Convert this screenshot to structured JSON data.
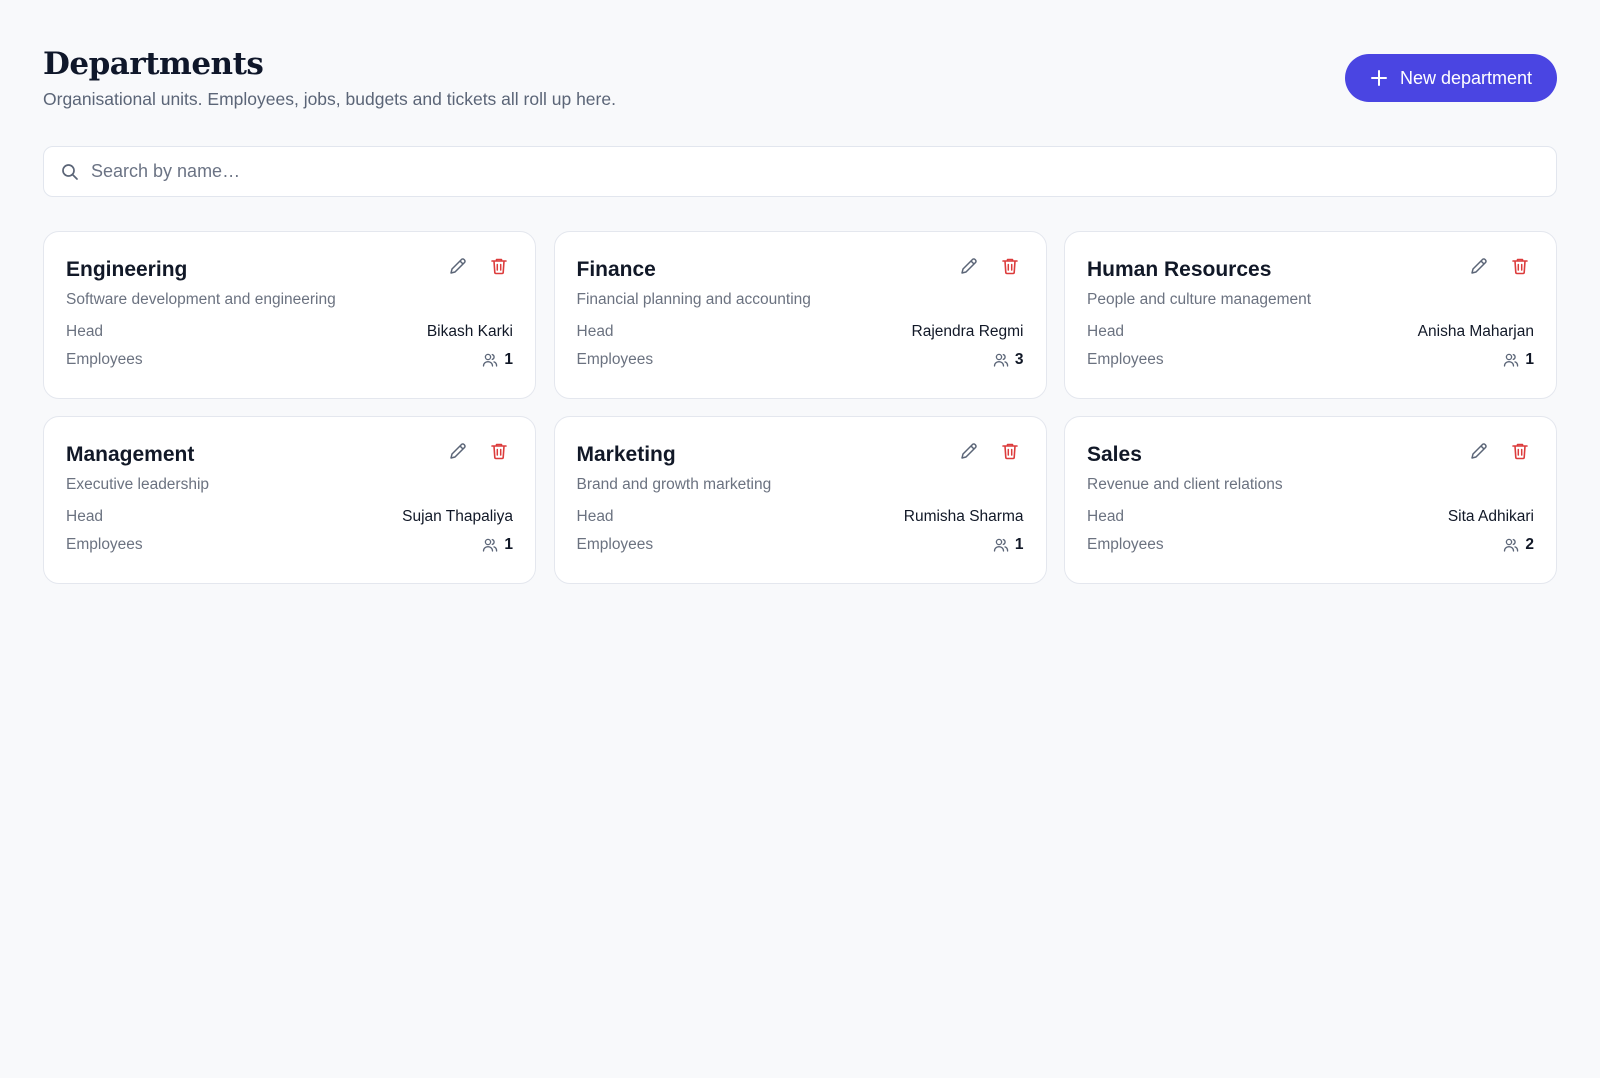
{
  "header": {
    "title": "Departments",
    "subtitle": "Organisational units. Employees, jobs, budgets and tickets all roll up here.",
    "new_button_label": "New department"
  },
  "search": {
    "placeholder": "Search by name…",
    "value": ""
  },
  "labels": {
    "head": "Head",
    "employees": "Employees"
  },
  "colors": {
    "accent": "#4a45e2",
    "delete": "#dc3b3b",
    "edit": "#5b6577"
  },
  "departments": [
    {
      "name": "Engineering",
      "description": "Software development and engineering",
      "head": "Bikash Karki",
      "employees": "1"
    },
    {
      "name": "Finance",
      "description": "Financial planning and accounting",
      "head": "Rajendra Regmi",
      "employees": "3"
    },
    {
      "name": "Human Resources",
      "description": "People and culture management",
      "head": "Anisha Maharjan",
      "employees": "1"
    },
    {
      "name": "Management",
      "description": "Executive leadership",
      "head": "Sujan Thapaliya",
      "employees": "1"
    },
    {
      "name": "Marketing",
      "description": "Brand and growth marketing",
      "head": "Rumisha Sharma",
      "employees": "1"
    },
    {
      "name": "Sales",
      "description": "Revenue and client relations",
      "head": "Sita Adhikari",
      "employees": "2"
    }
  ]
}
